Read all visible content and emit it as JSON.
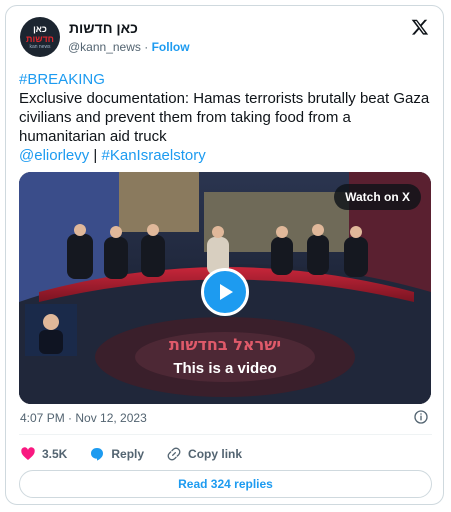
{
  "author": {
    "display_name": "כאן חדשות",
    "handle": "@kann_news",
    "follow_label": "Follow",
    "avatar_text_line1": "כאן",
    "avatar_text_line2": "חדשות",
    "avatar_text_line3": "kan news"
  },
  "tweet": {
    "hashtag": "#BREAKING",
    "body": "Exclusive documentation: Hamas terrorists brutally beat Gaza civilians and prevent them from taking food from a humanitarian aid truck",
    "mention": "@eliorlevy",
    "separator": "|",
    "tag": "#KanIsraelstory"
  },
  "media": {
    "watch_label": "Watch on X",
    "caption": "This is a video",
    "overlay_text": "ישראל בחדשות"
  },
  "meta": {
    "timestamp": "4:07 PM · Nov 12, 2023"
  },
  "actions": {
    "likes": "3.5K",
    "reply_label": "Reply",
    "copy_label": "Copy link"
  },
  "read_replies": "Read 324 replies",
  "colors": {
    "accent": "#1d9bf0",
    "like": "#f91880",
    "text": "#0f1419",
    "muted": "#536471"
  }
}
